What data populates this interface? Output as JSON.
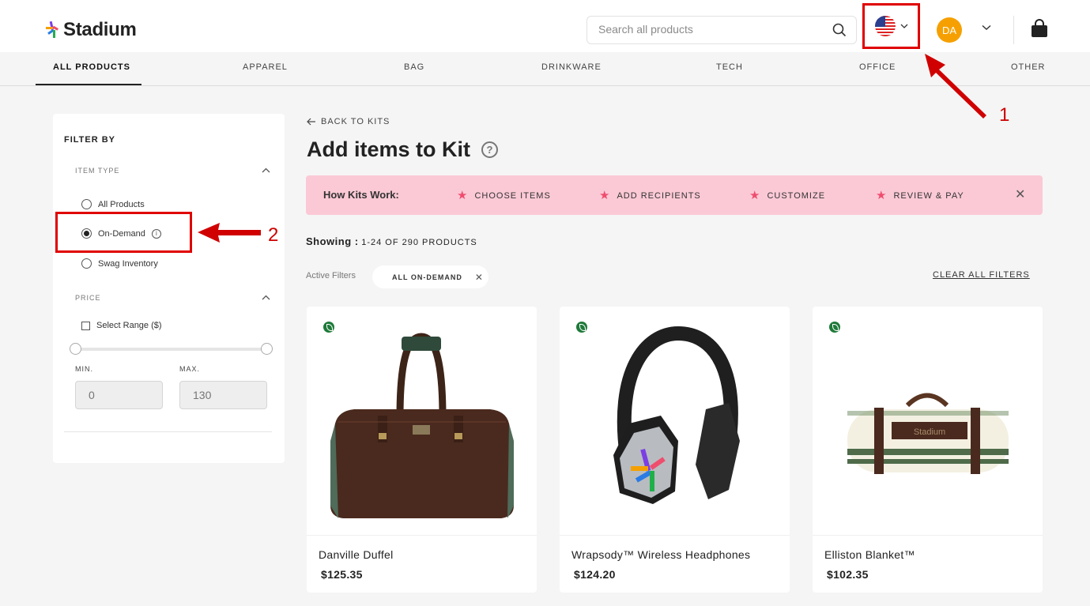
{
  "header": {
    "logo_text": "Stadium",
    "search_placeholder": "Search all products",
    "avatar_initials": "DA"
  },
  "nav": {
    "items": [
      "ALL PRODUCTS",
      "APPAREL",
      "BAG",
      "DRINKWARE",
      "TECH",
      "OFFICE",
      "OTHER"
    ],
    "active": "ALL PRODUCTS"
  },
  "sidebar": {
    "title": "FILTER BY",
    "item_type": {
      "label": "ITEM TYPE",
      "options": [
        "All Products",
        "On-Demand",
        "Swag Inventory"
      ],
      "selected": "On-Demand"
    },
    "price": {
      "label": "PRICE",
      "select_range_label": "Select Range ($)",
      "min_label": "MIN.",
      "max_label": "MAX.",
      "min_placeholder": "0",
      "max_placeholder": "130"
    }
  },
  "main": {
    "back_label": "BACK TO KITS",
    "title": "Add items to Kit",
    "banner": {
      "title": "How Kits Work:",
      "steps": [
        "CHOOSE ITEMS",
        "ADD RECIPIENTS",
        "CUSTOMIZE",
        "REVIEW & PAY"
      ]
    },
    "showing_label": "Showing :",
    "showing_count": "1-24 OF 290 PRODUCTS",
    "active_filters_label": "Active Filters",
    "active_filter_chip": "ALL ON-DEMAND",
    "clear_all_label": "CLEAR ALL FILTERS"
  },
  "products": [
    {
      "name": "Danville Duffel",
      "price": "$125.35"
    },
    {
      "name": "Wrapsody™ Wireless Headphones",
      "price": "$124.20"
    },
    {
      "name": "Elliston Blanket™",
      "price": "$102.35"
    }
  ],
  "product_image_text": {
    "blanket_label": "Stadium"
  },
  "annotations": {
    "one": "1",
    "two": "2"
  },
  "colors": {
    "accent_annotation": "#e00000",
    "banner_bg": "#fbc9d6",
    "star": "#ef4d6e",
    "avatar": "#f5a000",
    "eco_badge": "#1f7a3a"
  },
  "icons": [
    "stadium-logo-icon",
    "search-icon",
    "us-flag-icon",
    "chevron-down-icon",
    "cart-bag-icon",
    "chevron-up-icon",
    "info-icon",
    "arrow-left-icon",
    "help-icon",
    "star-icon",
    "close-icon",
    "leaf-icon"
  ]
}
